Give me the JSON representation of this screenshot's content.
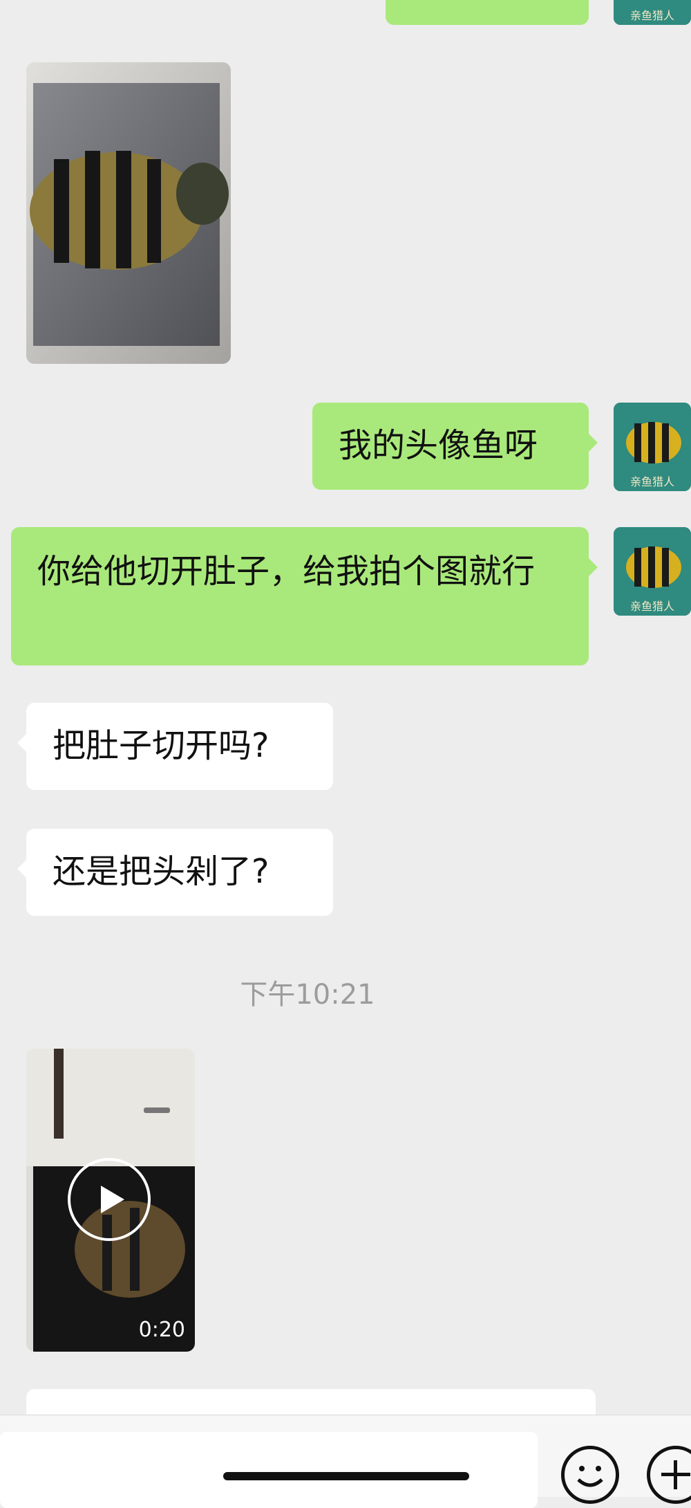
{
  "messages": {
    "m1": "我的头像鱼呀",
    "m2": "你给他切开肚子，给我拍个图就行",
    "m3": "把肚子切开吗?",
    "m4": "还是把头剁了?"
  },
  "avatar_caption": "亲鱼猎人",
  "timestamp": "下午10:21",
  "video": {
    "duration": "0:20"
  },
  "icons": {
    "avatar": "avatar-fish-icon",
    "play": "play-icon",
    "emoji": "emoji-icon",
    "add": "plus-icon"
  },
  "colors": {
    "background": "#ededed",
    "sent_bubble": "#a9e97b",
    "received_bubble": "#ffffff"
  }
}
